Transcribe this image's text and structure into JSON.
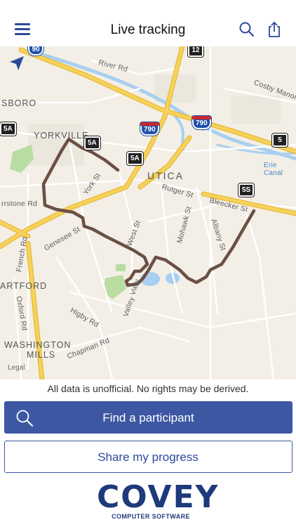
{
  "header": {
    "title": "Live tracking",
    "menu_icon": "hamburger-menu-icon",
    "search_icon": "search-icon",
    "share_icon": "share-icon"
  },
  "map": {
    "labels": {
      "river_rd": "River Rd",
      "cosby_manor": "Cosby Manor R",
      "sboro": "SBORO",
      "yorkville": "YORKVILLE",
      "utica": "UTICA",
      "york_st": "York St",
      "rutger_st": "Rutger St",
      "bleecker_st": "Bleecker St",
      "erie_canal": "Erie\nCanal",
      "rrstone_rd": "rrstone Rd",
      "genesee_st": "Genesee St",
      "west_st": "West St",
      "mohawk_st": "Mohawk St",
      "albany_st": "Albany St",
      "french_rd": "French Rd",
      "artford": "ARTFORD",
      "oxford_rd": "Oxford Rd",
      "higby_rd": "Higby Rd",
      "valley_view": "Valley View",
      "washington": "WASHINGTON",
      "mills": "MILLS",
      "chapman_rd": "Chapman Rd"
    },
    "shields": {
      "i90_top": "90",
      "r12": "12",
      "i790_a": "790",
      "i790_b": "790",
      "r5": "5",
      "r5a_left": "5A",
      "r5a_mid": "5A",
      "r5a_center": "5A",
      "r5s": "5S"
    },
    "legal": "Legal",
    "colors": {
      "route": "#6b4f45",
      "highway": "#f4cc4a",
      "water": "#a8cff0",
      "park": "#b9dca3",
      "land": "#f3efe6"
    }
  },
  "disclaimer": "All data is unofficial. No rights may be derived.",
  "actions": {
    "find_participant": "Find a participant",
    "share_progress": "Share my progress"
  },
  "logo": {
    "word": "COVEY",
    "tagline": "COMPUTER SOFTWARE"
  }
}
